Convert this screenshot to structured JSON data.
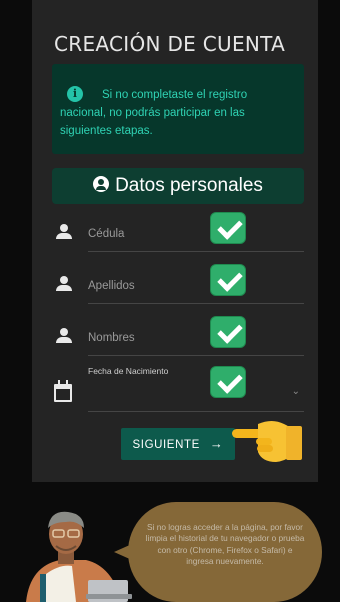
{
  "form": {
    "title": "CREACIÓN DE CUENTA",
    "alert": {
      "icon": "info-icon",
      "text": "Si no completaste el registro nacional, no podrás participar en las siguientes etapas."
    },
    "section_title": "Datos personales",
    "fields": [
      {
        "label": "Cédula",
        "icon": "person-icon",
        "status": "checked"
      },
      {
        "label": "Apellidos",
        "icon": "person-icon",
        "status": "checked"
      },
      {
        "label": "Nombres",
        "icon": "person-icon",
        "status": "checked"
      },
      {
        "label": "Fecha de Nacimiento",
        "icon": "calendar-icon",
        "status": "checked"
      }
    ],
    "submit_label": "SIGUIENTE",
    "submit_arrow": "→"
  },
  "help_bubble": {
    "text": "Si no logras acceder a la página, por favor limpia el historial de tu navegador o prueba con otro (Chrome, Firefox o Safari) e ingresa nuevamente."
  },
  "colors": {
    "card_bg": "#242424",
    "alert_bg": "#06372b",
    "alert_text": "#2fd3b4",
    "section_bg": "#0d3e31",
    "button_bg": "#0d5a4c",
    "check_green": "#2fae6b",
    "bubble_bg": "#8c6d3b"
  }
}
